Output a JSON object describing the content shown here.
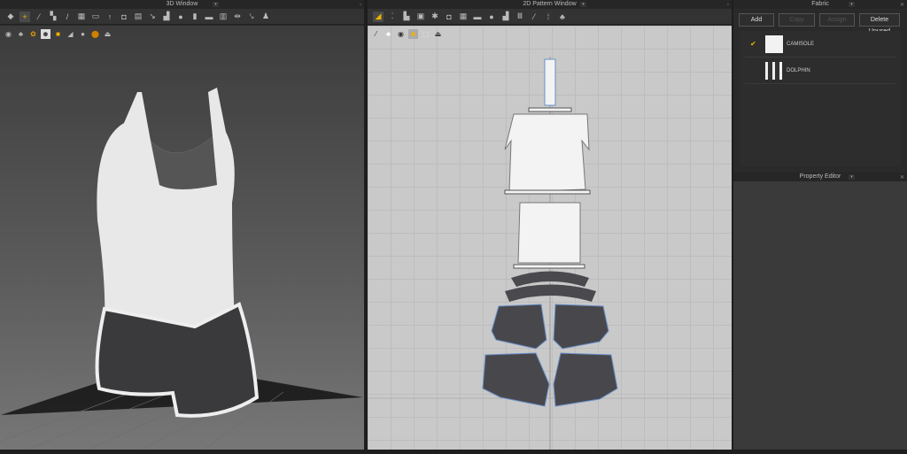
{
  "window3d": {
    "title": "3D Window",
    "toolbar": [
      "avatar",
      "select-move",
      "segment-sew",
      "free-sew",
      "line",
      "fold",
      "pin",
      "tack",
      "puckering",
      "steam",
      "tape",
      "tacking",
      "button",
      "buttonhole",
      "topstitch",
      "zipper",
      "elastic",
      "flip",
      "walk"
    ],
    "subtoolbar": [
      "avatar-display",
      "garment-display",
      "texture",
      "skin",
      "fabric",
      "mesh",
      "avatar-hide",
      "fabric-render",
      "export"
    ]
  },
  "window2d": {
    "title": "2D Pattern Window",
    "toolbar": [
      "transform",
      "edit-point",
      "polygon",
      "rectangle",
      "internal",
      "segment-sew",
      "free-sew",
      "fold",
      "tack",
      "steam",
      "tape",
      "line",
      "topstitch",
      "garment"
    ],
    "subtoolbar": [
      "sew",
      "trace",
      "measure",
      "fill",
      "mesh",
      "export"
    ]
  },
  "fabric": {
    "title": "Fabric",
    "buttons": {
      "add": "Add",
      "copy": "Copy",
      "assign": "Assign",
      "delete_unused": "Delete Unused"
    },
    "items": [
      {
        "name": "CAMISOLE",
        "selected": true
      },
      {
        "name": "DOLPHIN",
        "selected": false
      }
    ],
    "check_color": "#e8b800"
  },
  "property_editor": {
    "title": "Property Editor"
  }
}
